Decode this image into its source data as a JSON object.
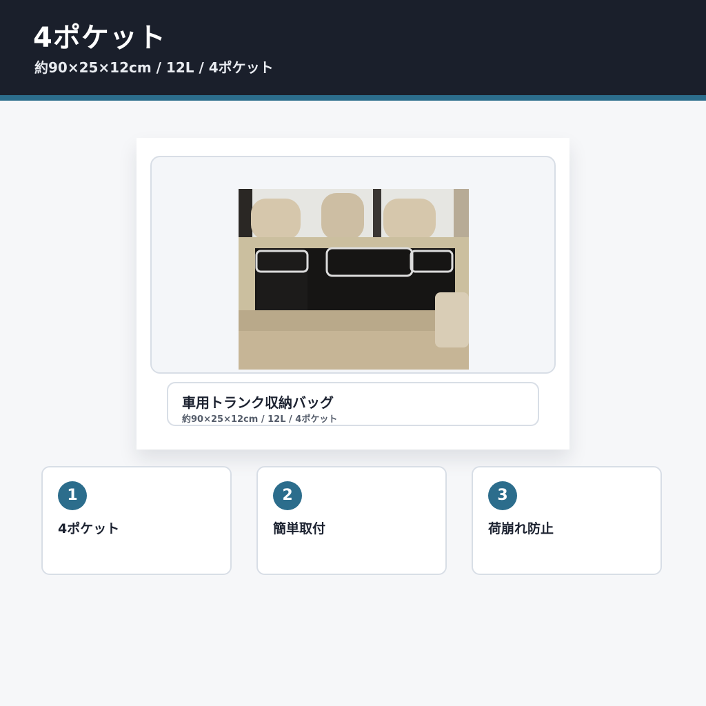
{
  "header": {
    "title": "4ポケット",
    "subtitle": "約90×25×12cm / 12L / 4ポケット"
  },
  "product": {
    "image_alt": "車用トランク収納バッグ photo",
    "name": "車用トランク収納バッグ",
    "specs": "約90×25×12cm / 12L / 4ポケット"
  },
  "features": [
    {
      "number": "1",
      "title": "4ポケット"
    },
    {
      "number": "2",
      "title": "簡単取付"
    },
    {
      "number": "3",
      "title": "荷崩れ防止"
    }
  ],
  "colors": {
    "header_bg": "#1a1f2b",
    "accent": "#2c6d8c",
    "page_bg": "#f6f7f9"
  }
}
